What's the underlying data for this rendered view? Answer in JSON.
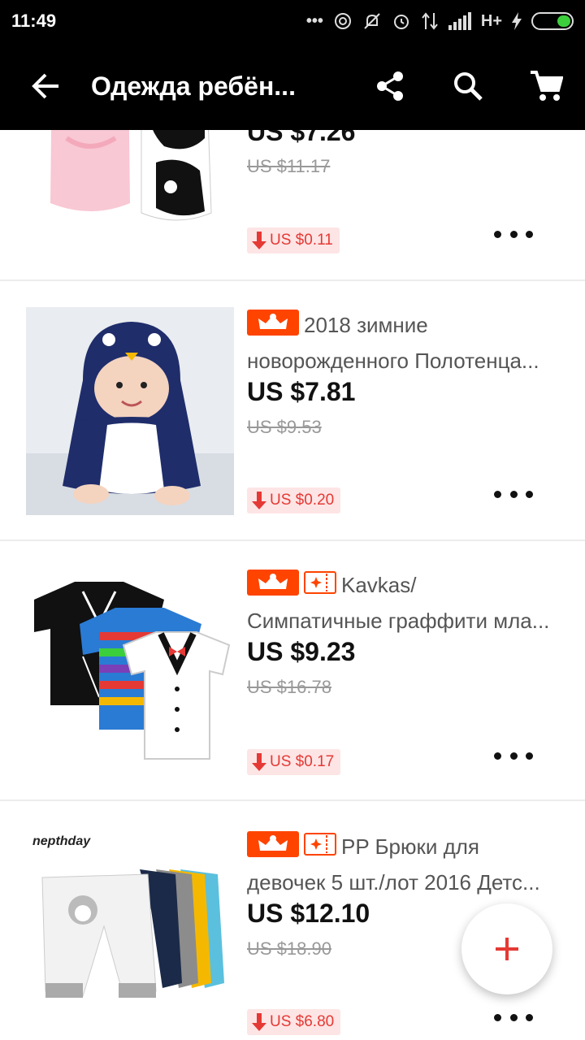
{
  "status": {
    "time": "11:49",
    "network": "H+"
  },
  "toolbar": {
    "title": "Одежда ребён..."
  },
  "products": [
    {
      "name_line1": "",
      "name_line2": "",
      "price": "US $7.26",
      "old_price": "US $11.17",
      "drop": "US $0.11",
      "thumb": "hooded-baby-towels"
    },
    {
      "name_line1": "2018 зимние",
      "name_line2": "новорожденного Полотенца...",
      "price": "US $7.81",
      "old_price": "US $9.53",
      "drop": "US $0.20",
      "thumb": "penguin-bathrobe"
    },
    {
      "name_line1": "Kavkas/",
      "name_line2": "Симпатичные граффити мла...",
      "price": "US $9.23",
      "old_price": "US $16.78",
      "drop": "US $0.17",
      "thumb": "baby-bodysuits"
    },
    {
      "name_line1": "PP Брюки для",
      "name_line2": "девочек 5 шт./лот 2016 Детс...",
      "price": "US $12.10",
      "old_price": "US $18.90",
      "drop": "US $6.80",
      "thumb": "baby-pants",
      "brand": "nepthday"
    }
  ],
  "colors": {
    "accent": "#ff4400",
    "drop_bg": "#fde5e5",
    "drop_text": "#e53935"
  }
}
